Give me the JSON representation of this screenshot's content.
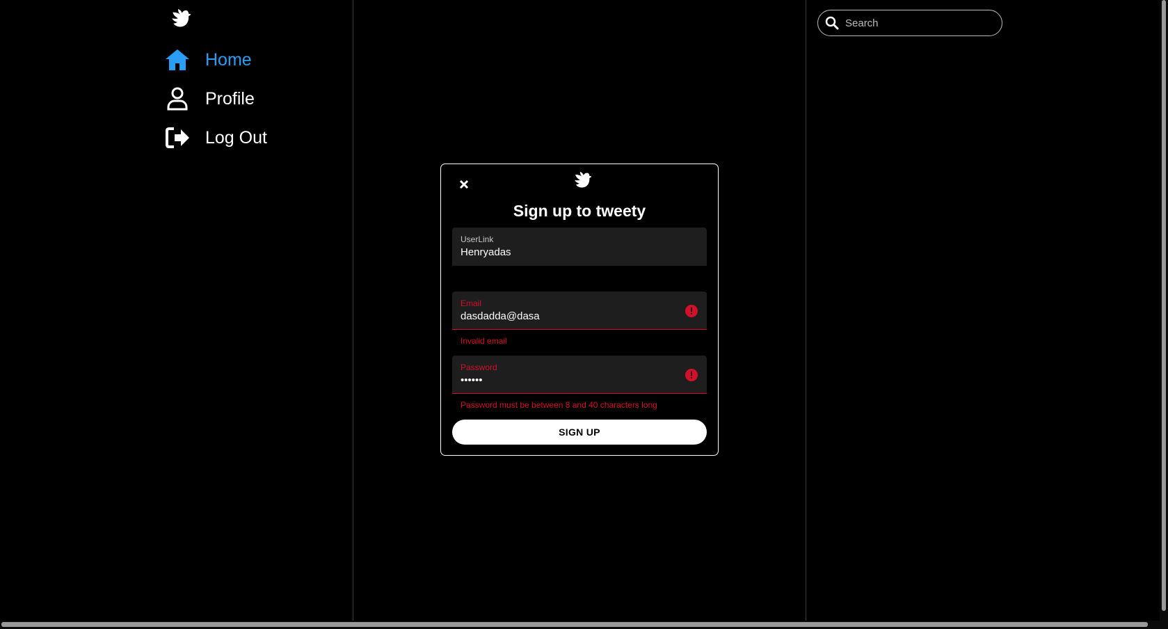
{
  "sidebar": {
    "logo_icon": "dove-icon",
    "items": [
      {
        "label": "Home",
        "icon": "home-icon",
        "active": true
      },
      {
        "label": "Profile",
        "icon": "user-icon",
        "active": false
      },
      {
        "label": "Log Out",
        "icon": "logout-icon",
        "active": false
      }
    ]
  },
  "search": {
    "placeholder": "Search",
    "value": "",
    "icon": "search-icon"
  },
  "modal": {
    "logo_icon": "dove-icon",
    "close_icon": "close-icon",
    "title": "Sign up to tweety",
    "fields": {
      "userlink": {
        "label": "UserLink",
        "value": "Henryadas"
      },
      "email": {
        "label": "Email",
        "value": "dasdadda@dasa",
        "error": "Invalid email",
        "error_icon": "error-icon"
      },
      "password": {
        "label": "Password",
        "value": "••••••",
        "error": "Password must be between 8 and 40 characters long",
        "error_icon": "error-icon"
      }
    },
    "submit_label": "SIGN UP"
  },
  "colors": {
    "background": "#000000",
    "accent": "#2a9df4",
    "error": "#d3102a",
    "field_bg": "#1e1e1e",
    "text": "#ffffff"
  }
}
